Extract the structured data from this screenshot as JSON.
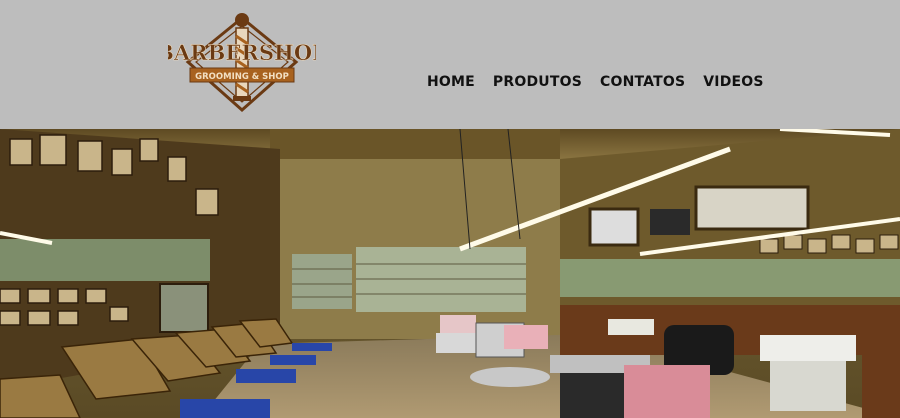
{
  "logo": {
    "line1": "BARBERSHOP",
    "line2": "GROOMING & SHOP",
    "colors": {
      "brown": "#6b3a13",
      "ribbon": "#a8621f",
      "cream": "#f2dfc2"
    }
  },
  "nav": {
    "items": [
      "HOME",
      "PRODUTOS",
      "CONTATOS",
      "VIDEOS"
    ]
  },
  "hero": {
    "scene": "barbershop-interior-photo"
  }
}
